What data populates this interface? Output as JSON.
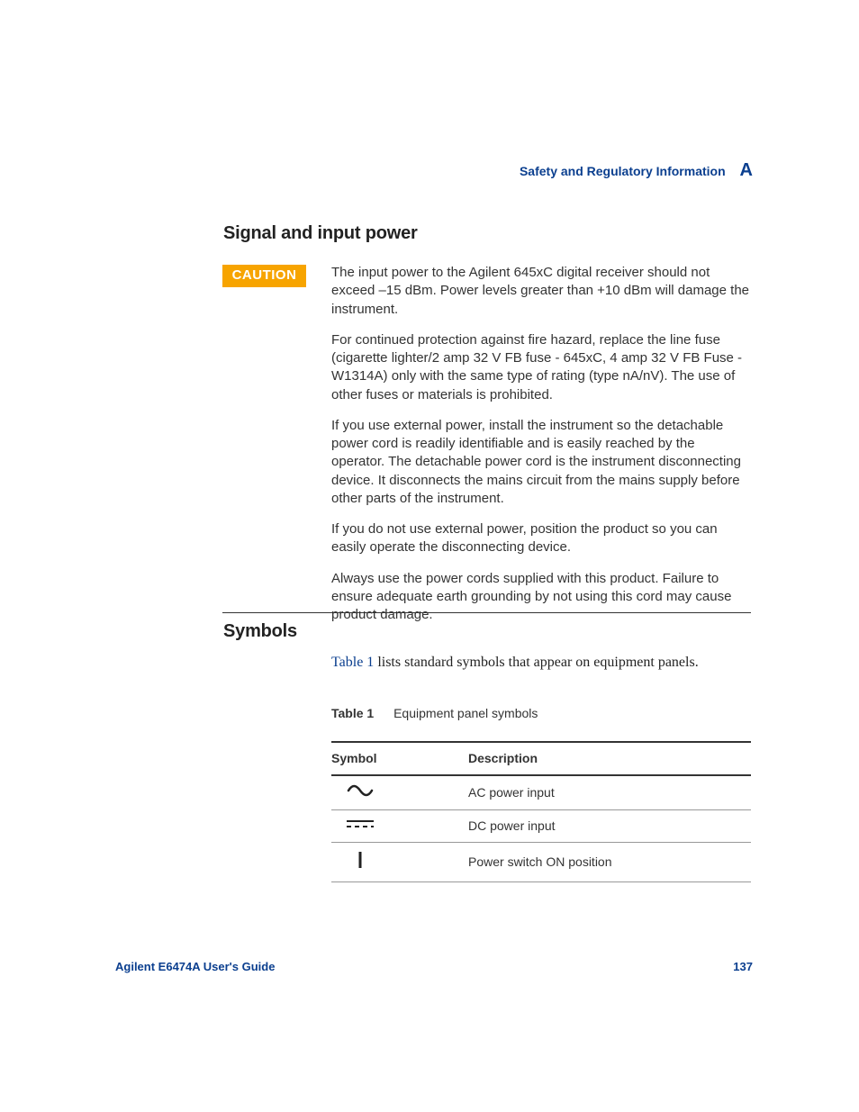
{
  "header": {
    "section_title": "Safety and Regulatory Information",
    "section_letter": "A"
  },
  "headings": {
    "signal": "Signal and input power",
    "symbols": "Symbols"
  },
  "caution": {
    "label": "CAUTION",
    "paragraphs": [
      "The input power to the Agilent 645xC digital receiver should not exceed –15 dBm. Power levels greater than +10 dBm will damage the instrument.",
      "For continued protection against fire hazard, replace the line fuse (cigarette lighter/2 amp 32 V FB fuse - 645xC, 4 amp 32 V FB Fuse - W1314A) only with the same type of rating (type nA/nV). The use of other fuses or materials is prohibited.",
      "If you use external power, install the instrument so the detachable power cord is readily identifiable and is easily reached by the operator. The detachable power cord is the instrument disconnecting device. It disconnects the mains circuit from the mains supply before other parts of the instrument.",
      "If you do not use external power, position the product so you can easily operate the disconnecting device.",
      "Always use the power cords supplied with this product. Failure to ensure adequate earth grounding by not using this cord may cause product damage."
    ]
  },
  "symbols_section": {
    "intro_link": "Table 1",
    "intro_rest": " lists standard symbols that appear on equipment panels.",
    "table_label": "Table 1",
    "table_title": "Equipment panel symbols",
    "columns": {
      "c0": "Symbol",
      "c1": "Description"
    },
    "rows": [
      {
        "icon": "ac-power-icon",
        "desc": "AC power input"
      },
      {
        "icon": "dc-power-icon",
        "desc": "DC power input"
      },
      {
        "icon": "power-on-icon",
        "desc": "Power switch ON position"
      }
    ]
  },
  "footer": {
    "guide": "Agilent E6474A User's Guide",
    "page": "137"
  },
  "colors": {
    "brand_blue": "#0b3f8f",
    "caution_orange": "#f7a400"
  }
}
